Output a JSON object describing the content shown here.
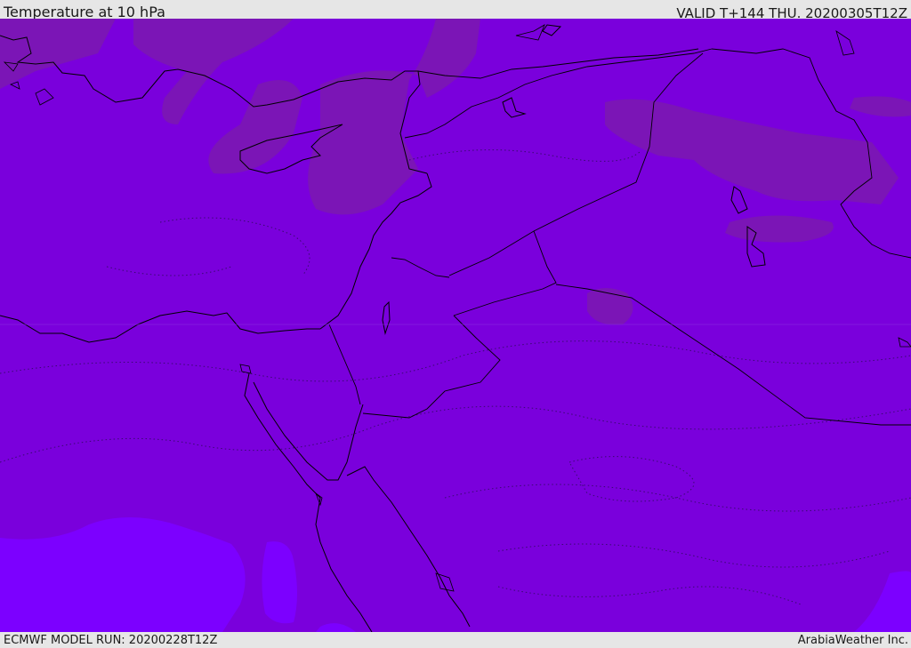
{
  "header": {
    "title": "Temperature at 10 hPa",
    "valid": "VALID T+144 THU. 20200305T12Z"
  },
  "footer": {
    "model_run": "ECMWF MODEL RUN: 20200228T12Z",
    "credit": "ArabiaWeather Inc."
  },
  "map": {
    "colors": {
      "base": "#7a00dc",
      "warm_patch": "#7a13b8",
      "cold_patch": "#7c00ff",
      "coastline": "#000000"
    }
  }
}
